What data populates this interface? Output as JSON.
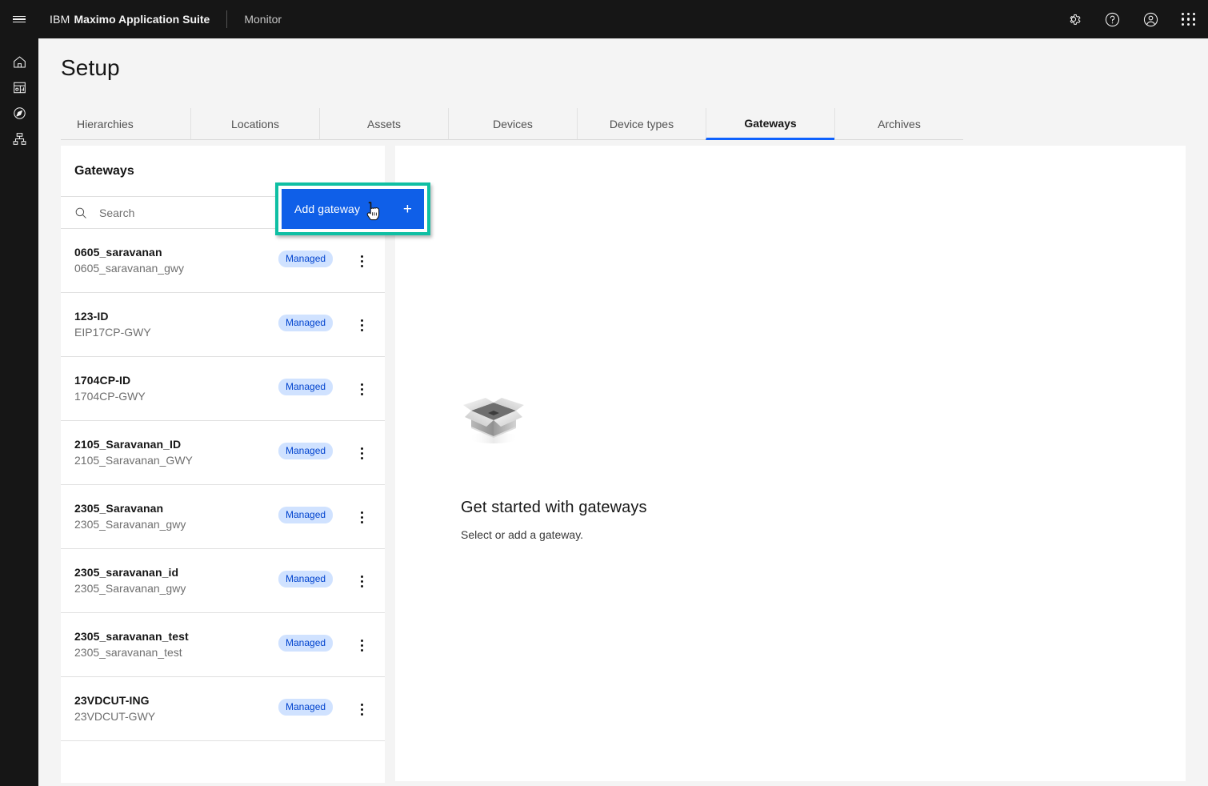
{
  "topbar": {
    "menu_icon": "hamburger-icon",
    "ibm": "IBM",
    "suite": "Maximo Application Suite",
    "module": "Monitor",
    "icons": [
      "gear-icon",
      "help-icon",
      "user-avatar-icon",
      "app-switcher-icon"
    ]
  },
  "rail": {
    "items": [
      {
        "icon": "home-icon",
        "name": "home"
      },
      {
        "icon": "dashboard-icon",
        "name": "dashboard"
      },
      {
        "icon": "explore-icon",
        "name": "explore"
      },
      {
        "icon": "hierarchy-icon",
        "name": "setup"
      }
    ]
  },
  "page": {
    "title": "Setup"
  },
  "tabs": [
    {
      "label": "Hierarchies",
      "active": false
    },
    {
      "label": "Locations",
      "active": false
    },
    {
      "label": "Assets",
      "active": false
    },
    {
      "label": "Devices",
      "active": false
    },
    {
      "label": "Device types",
      "active": false
    },
    {
      "label": "Gateways",
      "active": true
    },
    {
      "label": "Archives",
      "active": false
    }
  ],
  "list": {
    "title": "Gateways",
    "add_button": {
      "label": "Add gateway",
      "plus": "+"
    },
    "search": {
      "placeholder": "Search",
      "value": "",
      "icon": "search-icon"
    },
    "rows": [
      {
        "name": "0605_saravanan",
        "id": "0605_saravanan_gwy",
        "status": "Managed"
      },
      {
        "name": "123-ID",
        "id": "EIP17CP-GWY",
        "status": "Managed"
      },
      {
        "name": "1704CP-ID",
        "id": "1704CP-GWY",
        "status": "Managed"
      },
      {
        "name": "2105_Saravanan_ID",
        "id": "2105_Saravanan_GWY",
        "status": "Managed"
      },
      {
        "name": "2305_Saravanan",
        "id": "2305_Saravanan_gwy",
        "status": "Managed"
      },
      {
        "name": "2305_saravanan_id",
        "id": "2305_Saravanan_gwy",
        "status": "Managed"
      },
      {
        "name": "2305_saravanan_test",
        "id": "2305_saravanan_test",
        "status": "Managed"
      },
      {
        "name": "23VDCUT-ING",
        "id": "23VDCUT-GWY",
        "status": "Managed"
      }
    ]
  },
  "empty_state": {
    "illustration": "open-box-illustration",
    "title": "Get started with gateways",
    "subtitle": "Select or add a gateway."
  },
  "colors": {
    "accent_blue": "#0f62fe",
    "button_blue": "#0f5fe8",
    "highlight_teal": "#0fbfa3",
    "badge_bg": "#d0e2ff",
    "badge_text": "#0043ce",
    "header_black": "#161616",
    "page_bg": "#f4f4f4"
  }
}
